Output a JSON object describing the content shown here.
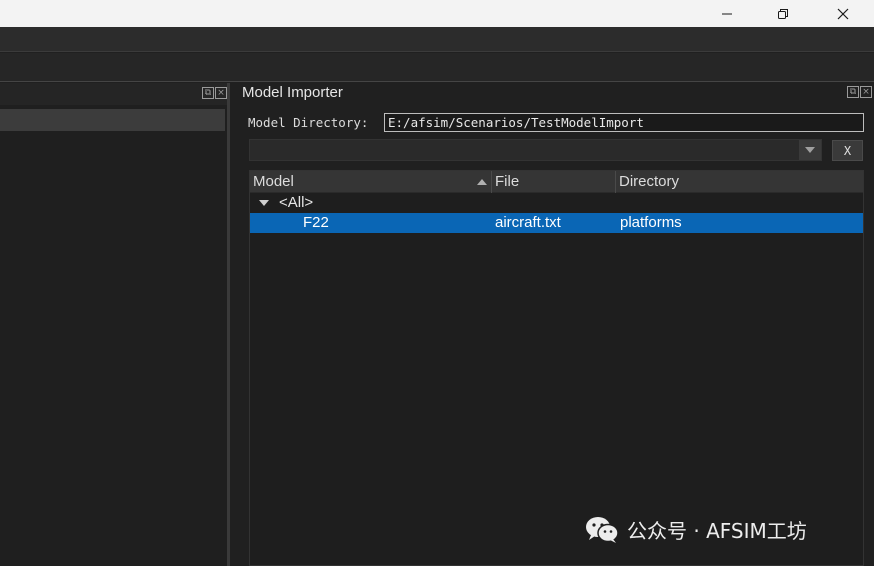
{
  "window": {
    "minimize_icon": "minimize-icon",
    "maximize_icon": "restore-icon",
    "close_icon": "close-icon"
  },
  "importer": {
    "title": "Model Importer",
    "directory_label": "Model Directory:",
    "directory_value": "E:/afsim/Scenarios/TestModelImport",
    "filter_value": "",
    "clear_label": "X",
    "columns": {
      "model": "Model",
      "file": "File",
      "directory": "Directory"
    },
    "rows": [
      {
        "model": "<All>",
        "file": "",
        "directory": ""
      },
      {
        "model": "F22",
        "file": "aircraft.txt",
        "directory": "platforms"
      }
    ],
    "selection_color": "#0a66b5"
  },
  "watermark": {
    "text": "公众号 · AFSIM工坊",
    "icon": "wechat-icon"
  }
}
